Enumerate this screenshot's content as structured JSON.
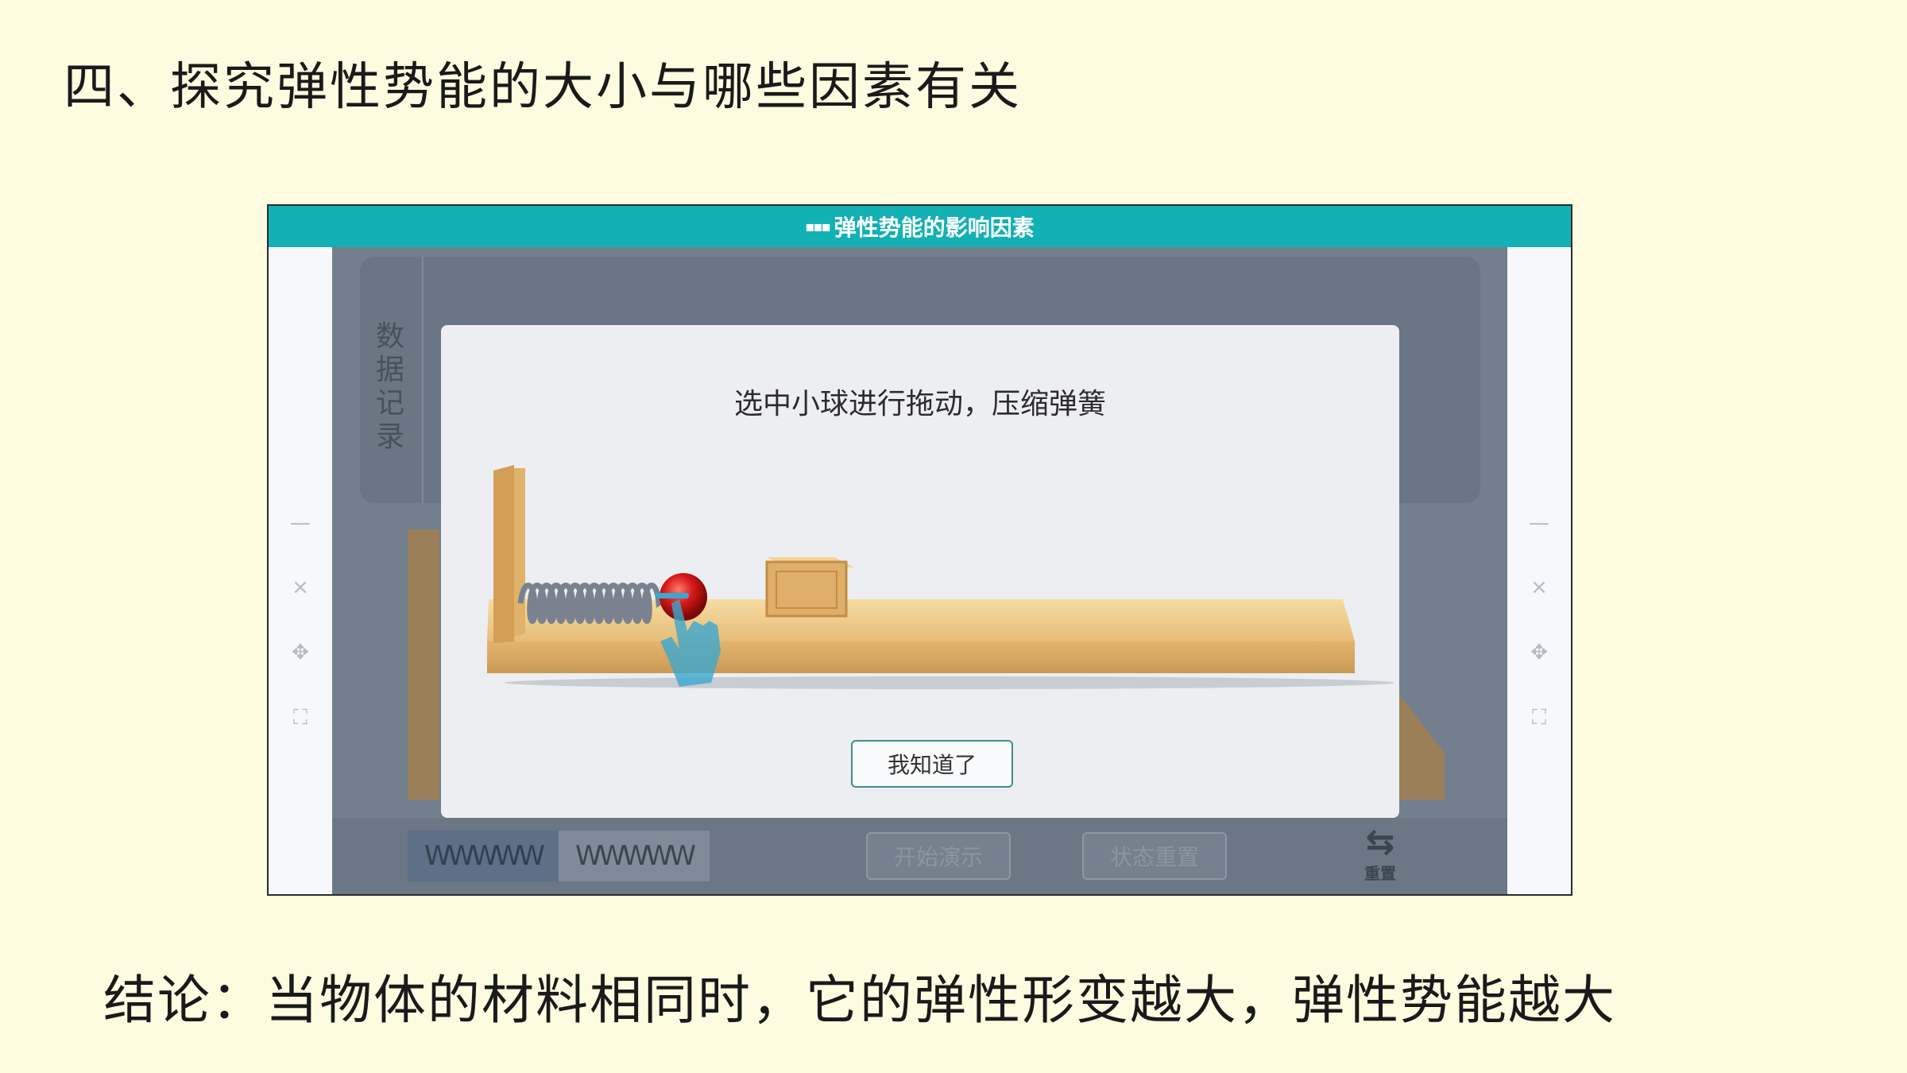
{
  "slide": {
    "title": "四、探究弹性势能的大小与哪些因素有关",
    "conclusion": "结论：当物体的材料相同时，它的弹性形变越大，弹性势能越大"
  },
  "app": {
    "title": "弹性势能的影响因素",
    "logo": "▪▪▪",
    "side_controls": [
      {
        "icon": "minimize-icon",
        "glyph": "—"
      },
      {
        "icon": "close-icon",
        "glyph": "×"
      },
      {
        "icon": "move-icon",
        "glyph": "✥"
      },
      {
        "icon": "fullscreen-icon",
        "glyph": "⛶"
      }
    ],
    "data_panel_label": "数据记录",
    "spring_tabs": [
      "WWWWW",
      "WWWWW"
    ],
    "start_button": "开始演示",
    "state_reset_button": "状态重置",
    "reset_label": "重置",
    "reset_glyph": "⇆"
  },
  "modal": {
    "instruction": "选中小球进行拖动，压缩弹簧",
    "ok_button": "我知道了"
  },
  "colors": {
    "titlebar": "#14b1b4",
    "background": "#fdfbe0",
    "wood": "#e8c07f",
    "ball": "#d81919"
  }
}
